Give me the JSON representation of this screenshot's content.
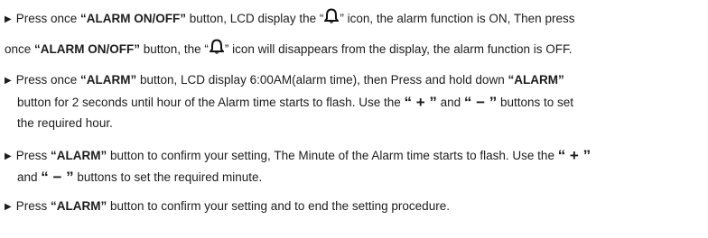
{
  "bullet": "▶",
  "para1": {
    "l1_a": "Press once ",
    "l1_b": "“ALARM ON/OFF”",
    "l1_c": " button, LCD display the “",
    "l1_d": "” icon, the alarm function is ON, Then press",
    "l2_a": "once ",
    "l2_b": "“ALARM ON/OFF”",
    "l2_c": " button, the “",
    "l2_d": "” icon will disappears from the display, the alarm function is OFF."
  },
  "para2": {
    "l1_a": "Press once ",
    "l1_b": "“ALARM”",
    "l1_c": " button, LCD display 6:00AM(alarm time), then Press and hold down ",
    "l1_d": "“ALARM”",
    "l2": "button for 2 seconds until hour of the Alarm time starts to flash. Use the ",
    "plus": "“ + ”",
    "and": " and ",
    "minus": "“ − ”",
    "l2_end": " buttons to set",
    "l3": "the required hour."
  },
  "para3": {
    "l1_a": "Press ",
    "l1_b": "“ALARM”",
    "l1_c": " button to confirm your setting, The Minute of the Alarm time starts to flash. Use the ",
    "plus": "“ + ”",
    "l2_a": "and ",
    "minus": "“ − ”",
    "l2_b": " buttons to set the required minute."
  },
  "para4": {
    "l1_a": "Press ",
    "l1_b": "“ALARM”",
    "l1_c": " button to confirm your setting and to end the setting procedure."
  },
  "icons": {
    "alarm": "alarm-bell-icon"
  }
}
